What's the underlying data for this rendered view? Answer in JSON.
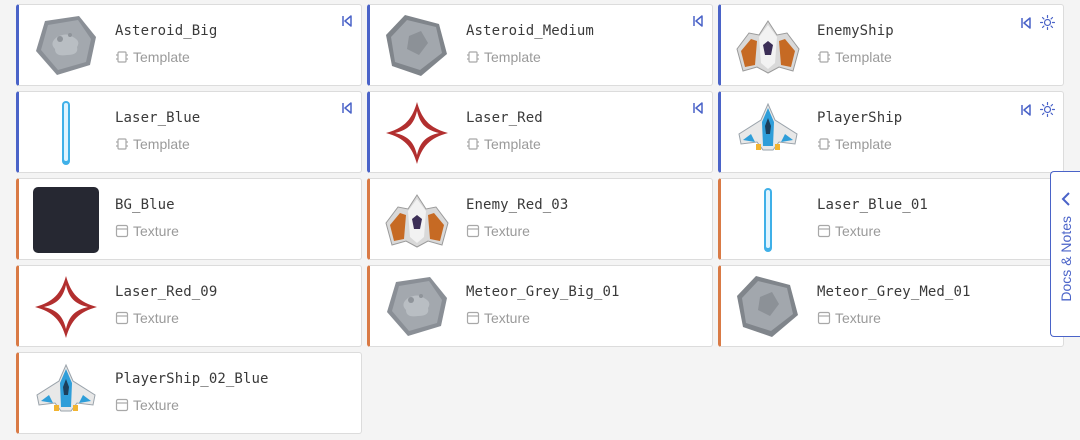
{
  "colors": {
    "template_accent": "#4a63c8",
    "texture_accent": "#d97a45"
  },
  "assets": [
    {
      "name": "Asteroid_Big",
      "type": "Template",
      "thumb": "meteor-big",
      "actions": [
        "revert-icon"
      ]
    },
    {
      "name": "Asteroid_Medium",
      "type": "Template",
      "thumb": "meteor-med",
      "actions": [
        "revert-icon"
      ]
    },
    {
      "name": "EnemyShip",
      "type": "Template",
      "thumb": "enemy-ship",
      "actions": [
        "revert-icon",
        "sun-icon"
      ]
    },
    {
      "name": "Laser_Blue",
      "type": "Template",
      "thumb": "laser-blue",
      "actions": [
        "revert-icon"
      ]
    },
    {
      "name": "Laser_Red",
      "type": "Template",
      "thumb": "laser-red",
      "actions": [
        "revert-icon"
      ]
    },
    {
      "name": "PlayerShip",
      "type": "Template",
      "thumb": "player-ship",
      "actions": [
        "revert-icon",
        "sun-icon"
      ]
    },
    {
      "name": "BG_Blue",
      "type": "Texture",
      "thumb": "bg-blue",
      "actions": []
    },
    {
      "name": "Enemy_Red_03",
      "type": "Texture",
      "thumb": "enemy-ship",
      "actions": []
    },
    {
      "name": "Laser_Blue_01",
      "type": "Texture",
      "thumb": "laser-blue",
      "actions": []
    },
    {
      "name": "Laser_Red_09",
      "type": "Texture",
      "thumb": "laser-red",
      "actions": []
    },
    {
      "name": "Meteor_Grey_Big_01",
      "type": "Texture",
      "thumb": "meteor-big",
      "actions": []
    },
    {
      "name": "Meteor_Grey_Med_01",
      "type": "Texture",
      "thumb": "meteor-med",
      "actions": []
    },
    {
      "name": "PlayerShip_02_Blue",
      "type": "Texture",
      "thumb": "player-ship",
      "actions": []
    }
  ],
  "docs_tab": {
    "label": "Docs & Notes",
    "icon": "chevron-left-icon"
  }
}
